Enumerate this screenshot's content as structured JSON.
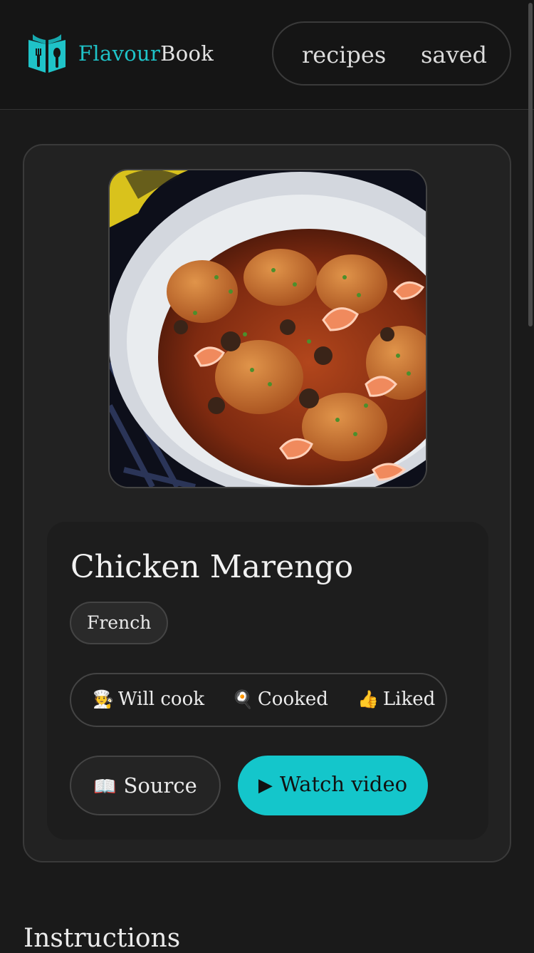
{
  "brand": {
    "part1": "Flavour",
    "part2": "Book",
    "accent": "#1fc3c8"
  },
  "nav": {
    "items": [
      "recipes",
      "saved"
    ]
  },
  "recipe": {
    "title": "Chicken Marengo",
    "tag": "French",
    "statuses": [
      {
        "icon": "chef-emoji",
        "glyph": "🧑‍🍳",
        "label": "Will cook"
      },
      {
        "icon": "frying-pan-emoji",
        "glyph": "🍳",
        "label": "Cooked"
      },
      {
        "icon": "thumbs-up-emoji",
        "glyph": "👍",
        "label": "Liked"
      }
    ],
    "source": {
      "icon": "book-emoji",
      "glyph": "📖",
      "label": "Source"
    },
    "video": {
      "icon": "play-icon",
      "glyph": "▶",
      "label": "Watch video",
      "color": "#14c6cb"
    }
  },
  "sections": {
    "instructions": "Instructions"
  }
}
